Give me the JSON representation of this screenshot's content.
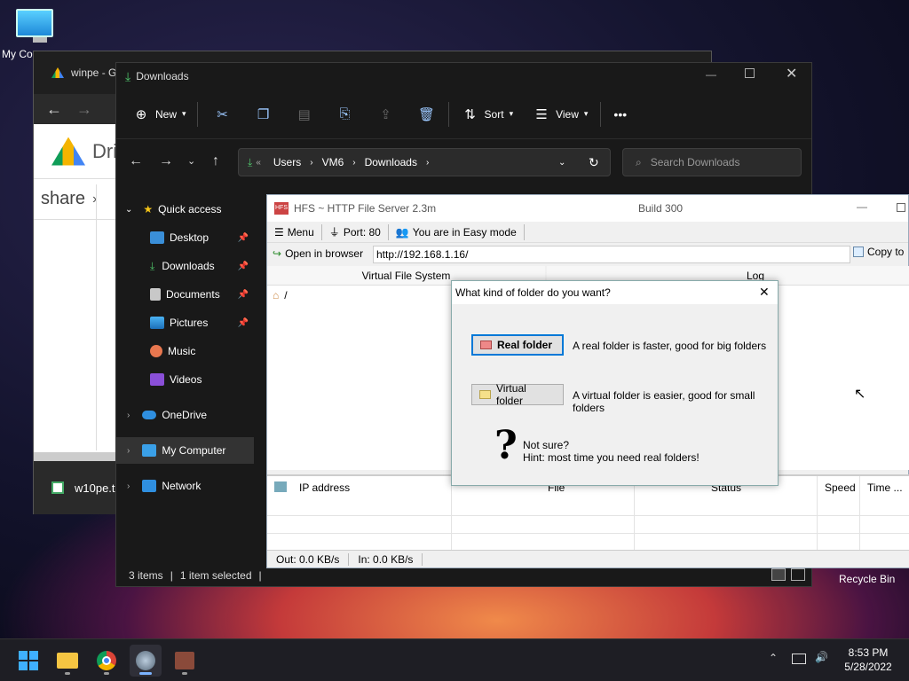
{
  "desktop": {
    "my_computer_label": "My Co",
    "recycle_bin_label": "Recycle Bin"
  },
  "chrome": {
    "tab_label": "winpe - G",
    "drive_label": "Dri",
    "share_label": "share",
    "download_label": "w10pe.t"
  },
  "explorer": {
    "title": "Downloads",
    "toolbar": {
      "new": "New",
      "sort": "Sort",
      "view": "View",
      "more": "•••"
    },
    "address": {
      "prefix": "«",
      "segments": [
        "Users",
        "VM6",
        "Downloads"
      ]
    },
    "search_placeholder": "Search Downloads",
    "nav": {
      "quick_access": "Quick access",
      "desktop": "Desktop",
      "downloads": "Downloads",
      "documents": "Documents",
      "pictures": "Pictures",
      "music": "Music",
      "videos": "Videos",
      "onedrive": "OneDrive",
      "my_computer": "My Computer",
      "network": "Network"
    },
    "status": {
      "items": "3 items",
      "selected": "1 item selected"
    }
  },
  "hfs": {
    "title": "HFS ~ HTTP File Server 2.3m",
    "build": "Build 300",
    "menu": {
      "menu": "Menu",
      "port": "Port: 80",
      "mode": "You are in Easy mode"
    },
    "open_browser": "Open in browser",
    "url": "http://192.168.1.16/",
    "copy_to": "Copy to",
    "vfs_header": "Virtual File System",
    "log_header": "Log",
    "root": "/",
    "columns": {
      "ip": "IP address",
      "file": "File",
      "status": "Status",
      "speed": "Speed",
      "time": "Time ..."
    },
    "status": {
      "out": "Out: 0.0 KB/s",
      "in": "In: 0.0 KB/s"
    }
  },
  "dialog": {
    "title": "What kind of folder do you want?",
    "real_btn": "Real folder",
    "real_desc": "A real folder is faster, good for big folders",
    "virtual_btn": "Virtual folder",
    "virtual_desc": "A virtual folder is easier, good for small folders",
    "not_sure": "Not sure?",
    "hint": "Hint: most time you need real folders!"
  },
  "taskbar": {
    "time": "8:53 PM",
    "date": "5/28/2022"
  },
  "colors": {
    "explorer_bg": "#191919",
    "accent": "#0078d7",
    "taskbar_bg": "#1e1e24"
  }
}
